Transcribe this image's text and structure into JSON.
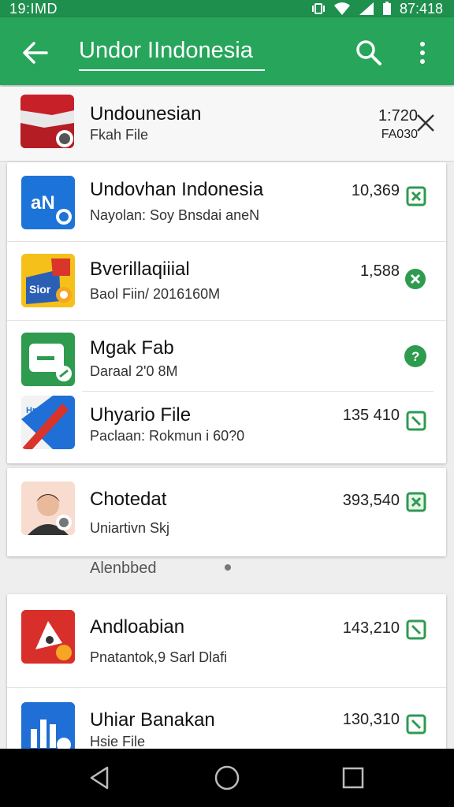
{
  "status_bar": {
    "time": "19:IMD",
    "clock_right": "87:418"
  },
  "toolbar": {
    "title": "Undor IIndonesia",
    "back_icon": "arrow-left-icon",
    "search_icon": "search-icon",
    "menu_icon": "more-vert-icon"
  },
  "top_item": {
    "name": "Undounesian",
    "sub": "Fkah File",
    "count": "1:720",
    "count2": "FA030"
  },
  "colors": {
    "primary": "#27a55b",
    "status": "#1f8f4e",
    "accent_green": "#2e9b4f"
  },
  "list1": [
    {
      "name": "Undovhan Indonesia",
      "sub": "Nayolan: Soy Bnsdai aneN",
      "count": "10,369"
    },
    {
      "name": "Bverillaqiiial",
      "sub": "Baol Fiin/ 2016160M",
      "count": "1,588"
    },
    {
      "name": "Mgak Fab",
      "sub": "Daraal 2'0 8M",
      "count": ""
    },
    {
      "name": "Uhyario File",
      "sub": "Paclaan: Rokmun i 60?0",
      "count": "135 410"
    }
  ],
  "list2": [
    {
      "name": "Chotedat",
      "sub": "Uniartivn Skj",
      "count": "393,540"
    }
  ],
  "section_label": "Alenbbed",
  "list3": [
    {
      "name": "Andloabian",
      "sub": "Pnatantok,9 Sarl Dlafi",
      "count": "143,210"
    },
    {
      "name": "Uhiar Banakan",
      "sub": "Hsie File",
      "count": "130,310"
    }
  ]
}
